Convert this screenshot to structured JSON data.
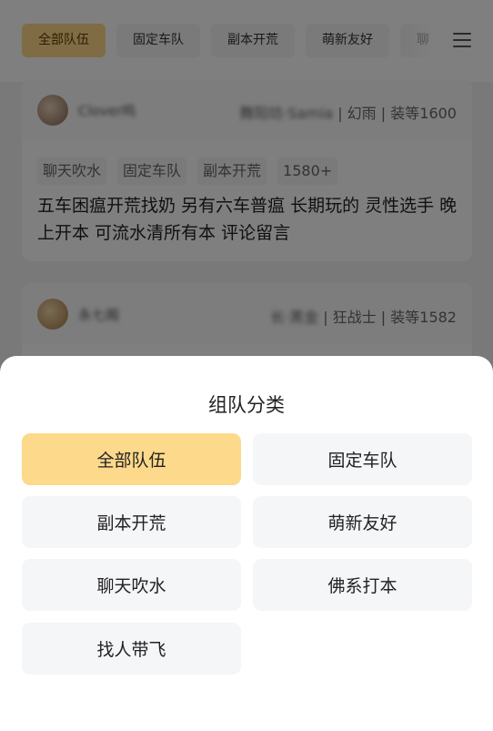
{
  "filters": {
    "items": [
      "全部队伍",
      "固定车队",
      "副本开荒",
      "萌新友好",
      "聊"
    ],
    "active_index": 0
  },
  "cards": [
    {
      "nickname": "Clover鸣",
      "server": "舞阳坊·Samia",
      "class": "幻雨",
      "gear": "装等1600",
      "tags": [
        "聊天吹水",
        "固定车队",
        "副本开荒",
        "1580+"
      ],
      "text": "五车困瘟开荒找奶 另有六车普瘟 长期玩的 灵性选手 晚上开本 可流水清所有本 评论留言"
    },
    {
      "nickname": "永七阁",
      "server": "长·黑金",
      "class": "狂战士",
      "gear": "装等1582",
      "tags": [],
      "text": ""
    }
  ],
  "sheet": {
    "title": "组队分类",
    "options": [
      "全部队伍",
      "固定车队",
      "副本开荒",
      "萌新友好",
      "聊天吹水",
      "佛系打本",
      "找人带飞"
    ],
    "selected_index": 0,
    "selected_color": "#fdd98b"
  },
  "colors": {
    "accent": "#fdd98b",
    "option_bg": "#f5f6f8"
  }
}
